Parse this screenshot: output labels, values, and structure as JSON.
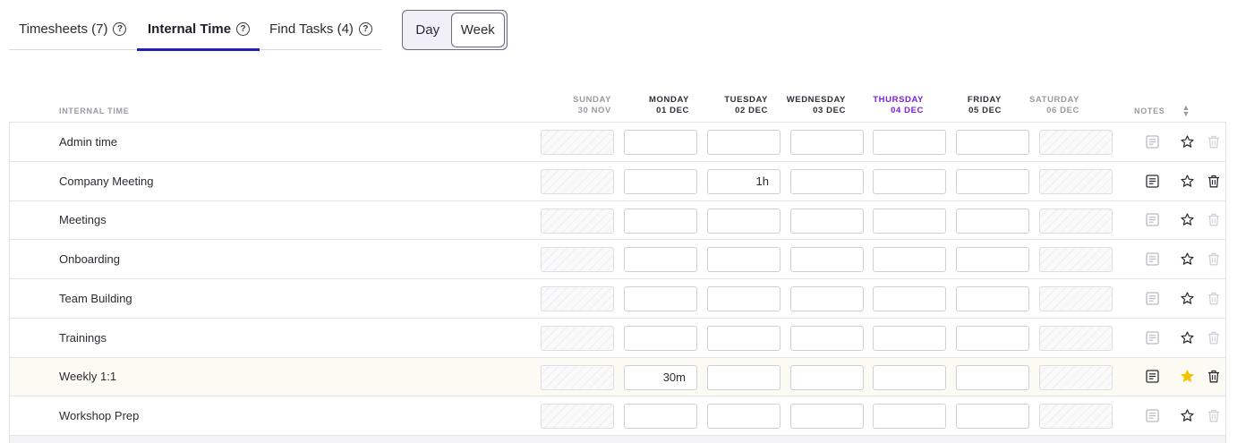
{
  "tabs": [
    {
      "label": "Timesheets (7)",
      "help": "?"
    },
    {
      "label": "Internal Time",
      "help": "?"
    },
    {
      "label": "Find Tasks (4)",
      "help": "?"
    }
  ],
  "view_toggle": {
    "day": "Day",
    "week": "Week",
    "selected": "Week"
  },
  "columns": {
    "label": "INTERNAL TIME",
    "notes": "NOTES",
    "days": [
      {
        "day": "SUNDAY",
        "date": "30 NOV"
      },
      {
        "day": "MONDAY",
        "date": "01 DEC"
      },
      {
        "day": "TUESDAY",
        "date": "02 DEC"
      },
      {
        "day": "WEDNESDAY",
        "date": "03 DEC"
      },
      {
        "day": "THURSDAY",
        "date": "04 DEC"
      },
      {
        "day": "FRIDAY",
        "date": "05 DEC"
      },
      {
        "day": "SATURDAY",
        "date": "06 DEC"
      }
    ]
  },
  "rows": [
    {
      "name": "Admin time",
      "values": [
        "",
        "",
        "",
        "",
        "",
        "",
        ""
      ],
      "has_notes": false,
      "favorite": false,
      "deletable": false
    },
    {
      "name": "Company Meeting",
      "values": [
        "",
        "",
        "1h",
        "",
        "",
        "",
        ""
      ],
      "has_notes": true,
      "favorite": false,
      "deletable": true
    },
    {
      "name": "Meetings",
      "values": [
        "",
        "",
        "",
        "",
        "",
        "",
        ""
      ],
      "has_notes": false,
      "favorite": false,
      "deletable": false
    },
    {
      "name": "Onboarding",
      "values": [
        "",
        "",
        "",
        "",
        "",
        "",
        ""
      ],
      "has_notes": false,
      "favorite": false,
      "deletable": false
    },
    {
      "name": "Team Building",
      "values": [
        "",
        "",
        "",
        "",
        "",
        "",
        ""
      ],
      "has_notes": false,
      "favorite": false,
      "deletable": false
    },
    {
      "name": "Trainings",
      "values": [
        "",
        "",
        "",
        "",
        "",
        "",
        ""
      ],
      "has_notes": false,
      "favorite": false,
      "deletable": false
    },
    {
      "name": "Weekly 1:1",
      "values": [
        "",
        "30m",
        "",
        "",
        "",
        "",
        ""
      ],
      "has_notes": true,
      "favorite": true,
      "deletable": true
    },
    {
      "name": "Workshop Prep",
      "values": [
        "",
        "",
        "",
        "",
        "",
        "",
        ""
      ],
      "has_notes": false,
      "favorite": false,
      "deletable": false
    }
  ],
  "colors": {
    "accent": "#1e22b8",
    "today": "#7a20d8",
    "favorite": "#f5c400"
  }
}
